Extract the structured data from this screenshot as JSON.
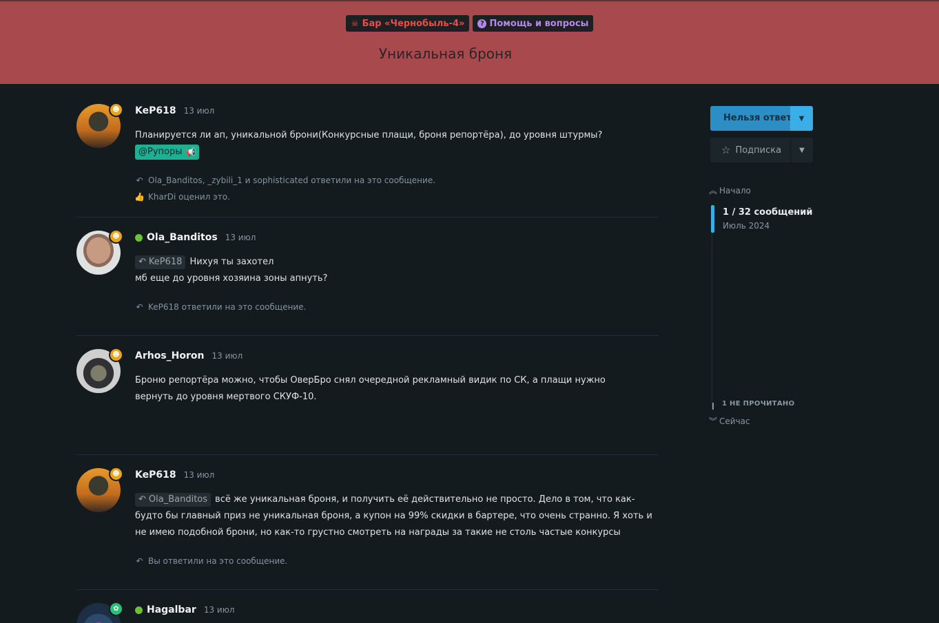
{
  "header": {
    "categories": [
      {
        "icon": "skull-crossbones-icon",
        "label": "Бар «Чернобыль-4»",
        "color": "#e84d4a"
      },
      {
        "icon": "question-circle-icon",
        "label": "Помощь и вопросы",
        "color": "#b28ae8"
      }
    ],
    "title": "Уникальная броня"
  },
  "posts": [
    {
      "username": "KeP618",
      "date": "13 июл",
      "flair_icon": "skull-icon",
      "text": "Планируется ли ап, уникальной брони(Конкурсные плащи, броня репортёра), до уровня штурмы?",
      "tag": "@Рупоры",
      "replies_line": "Ola_Banditos, _zybili_1 и sophisticated ответили на это сообщение.",
      "likes_line": "KharDi оценил это."
    },
    {
      "username": "Ola_Banditos",
      "online": true,
      "date": "13 июл",
      "flair_icon": "skull-icon",
      "reply_to": "KeP618",
      "text_line1": "Нихуя ты захотел",
      "text_line2": "мб еще до уровня хозяина зоны апнуть?",
      "replies_line": "KeP618 ответили на это сообщение."
    },
    {
      "username": "Arhos_Horon",
      "date": "13 июл",
      "flair_icon": "skull-icon",
      "text": "Броню репортёра можно, чтобы ОверБро снял очередной рекламный видик по СК, а плащи нужно вернуть до уровня мертвого СКУФ-10."
    },
    {
      "username": "KeP618",
      "date": "13 июл",
      "flair_icon": "skull-icon",
      "reply_to": "Ola_Banditos",
      "text": "всё же уникальная броня, и получить её действительно не просто. Дело в том, что как-будто бы главный приз не уникальная броня, а купон на 99% скидки в бартере, что очень странно. Я хоть и не имею подобной брони, но как-то грустно смотреть на награды за такие не столь частые конкурсы",
      "replies_line": "Вы ответили на это сообщение."
    },
    {
      "username": "Hagalbar",
      "online": true,
      "date": "13 июл",
      "flair_icon": "frog-icon"
    }
  ],
  "sidebar": {
    "reply_button": "Нельзя ответить",
    "subscribe_button": "Подписка",
    "timeline": {
      "start": "Начало",
      "count": "1 / 32 сообщений",
      "date": "Июль 2024",
      "unread": "1 НЕ ПРОЧИТАНО",
      "now": "Сейчас"
    }
  }
}
